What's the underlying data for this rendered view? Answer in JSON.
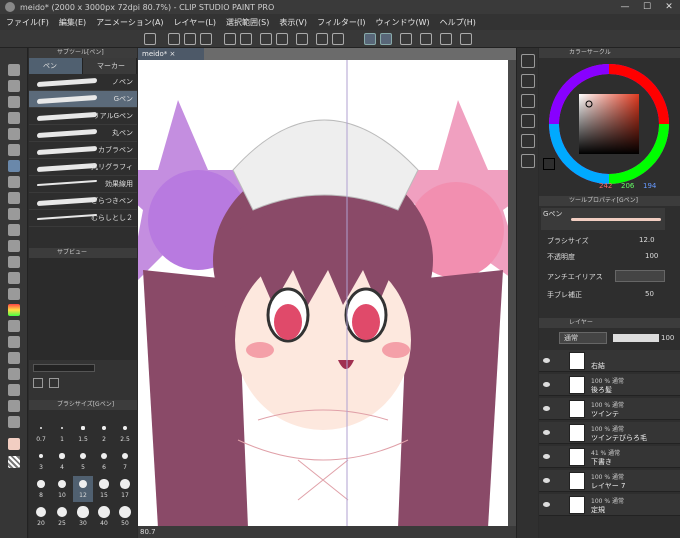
{
  "titlebar": {
    "title": "meido* (2000 x 3000px 72dpi 80.7%) - CLIP STUDIO PAINT PRO",
    "minimize": "—",
    "maximize": "☐",
    "close": "✕"
  },
  "menu": [
    "ファイル(F)",
    "編集(E)",
    "アニメーション(A)",
    "レイヤー(L)",
    "選択範囲(S)",
    "表示(V)",
    "フィルター(I)",
    "ウィンドウ(W)",
    "ヘルプ(H)"
  ],
  "subtool": {
    "header": "サブツール[ペン]",
    "tabs": [
      "ペン",
      "マーカー"
    ],
    "brushes": [
      "ノペン",
      "Gペン",
      "リアルGペン",
      "丸ペン",
      "カブラペン",
      "丸リグラフィ",
      "効果線用",
      "ざらつきペン",
      "むらしとし２"
    ],
    "selected_index": 1
  },
  "subview": {
    "header": "サブビュー"
  },
  "brushsize": {
    "header": "ブラシサイズ[Gペン]",
    "values": [
      "0.7",
      "1",
      "1.5",
      "2",
      "2.5",
      "3",
      "4",
      "5",
      "6",
      "7",
      "8",
      "10",
      "12",
      "15",
      "17",
      "20",
      "25",
      "30",
      "40",
      "50"
    ],
    "selected": "12"
  },
  "document": {
    "tab_label": "meido*",
    "zoom": "80.7"
  },
  "colorpanel": {
    "header": "カラーサークル",
    "r": "242",
    "g": "206",
    "b": "194",
    "main_color": "#f2cec2"
  },
  "toolprop": {
    "header": "ツールプロパティ[Gペン]",
    "name": "Gペン",
    "rows": [
      {
        "label": "ブラシサイズ",
        "value": "12.0"
      },
      {
        "label": "不透明度",
        "value": "100"
      },
      {
        "label": "アンチエイリアス",
        "value": ""
      },
      {
        "label": "手ブレ補正",
        "value": "50"
      }
    ]
  },
  "layers": {
    "header": "レイヤー",
    "blend_mode": "通常",
    "opacity": "100",
    "items": [
      {
        "line1": "",
        "line2": "右結"
      },
      {
        "line1": "100 % 通常",
        "line2": "後ろ髪"
      },
      {
        "line1": "100 % 通常",
        "line2": "ツインテ"
      },
      {
        "line1": "100 % 通常",
        "line2": "ツインテびらろ毛"
      },
      {
        "line1": "41 % 通常",
        "line2": "下書き"
      },
      {
        "line1": "100 % 通常",
        "line2": "レイヤー 7"
      },
      {
        "line1": "100 % 通常",
        "line2": "定規"
      }
    ]
  }
}
